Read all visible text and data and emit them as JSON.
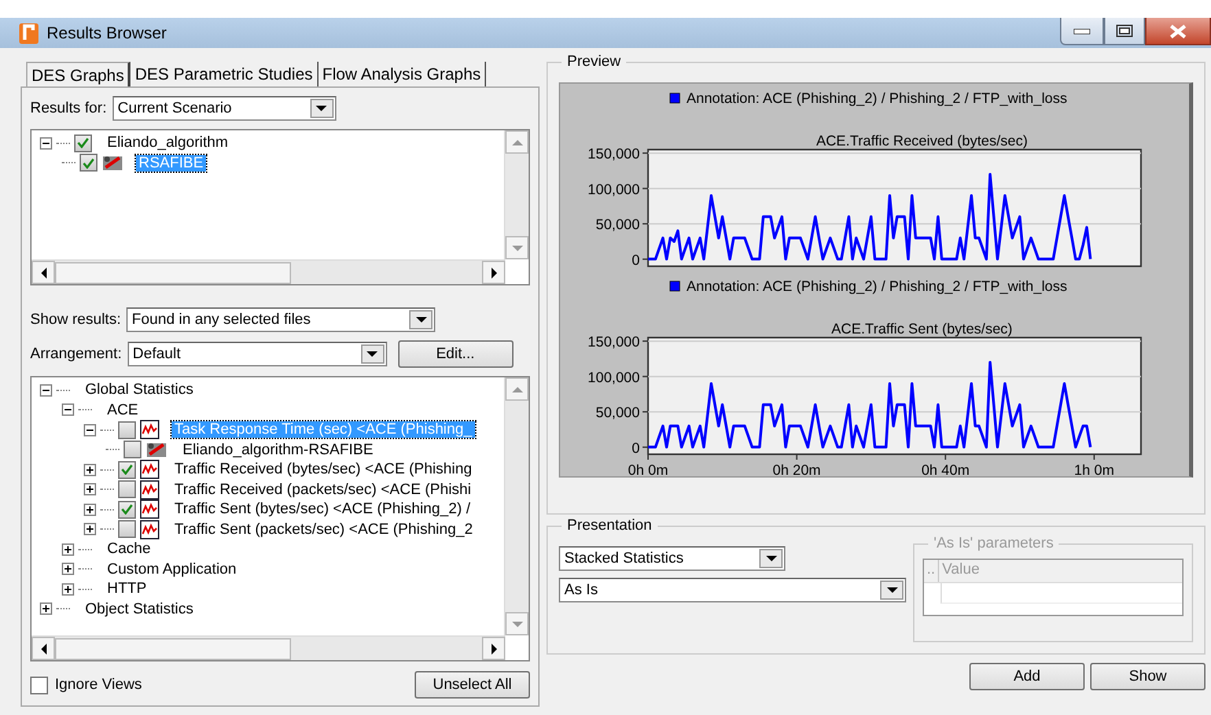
{
  "window": {
    "title": "Results Browser"
  },
  "tabs": [
    {
      "label": "DES Graphs",
      "selected": true
    },
    {
      "label": "DES Parametric Studies",
      "selected": false
    },
    {
      "label": "Flow Analysis Graphs",
      "selected": false
    }
  ],
  "results_for": {
    "label": "Results for:",
    "value": "Current Scenario"
  },
  "results_tree": [
    {
      "label": "Eliando_algorithm",
      "expanded": true,
      "checked": true,
      "selected": false,
      "children": [
        {
          "label": "RSAFIBE",
          "kind": "scenario",
          "checked": true,
          "selected": true
        }
      ]
    }
  ],
  "show_results": {
    "label": "Show results:",
    "value": "Found in any selected files"
  },
  "arrangement": {
    "label": "Arrangement:",
    "value": "Default",
    "button": "Edit..."
  },
  "statistics_tree": [
    {
      "label": "Global Statistics",
      "expanded": true,
      "selected": false,
      "children": [
        {
          "label": "ACE",
          "expanded": true,
          "selected": false,
          "children": [
            {
              "label": "Task Response Time (sec) <ACE (Phishing_",
              "kind": "statistic",
              "expanded": true,
              "checked": false,
              "selected": true,
              "children": [
                {
                  "label": "Eliando_algorithm-RSAFIBE",
                  "kind": "scenario",
                  "checked": false,
                  "selected": false
                }
              ]
            },
            {
              "label": "Traffic Received (bytes/sec) <ACE (Phishing",
              "kind": "statistic",
              "expanded": false,
              "checked": true,
              "selected": false
            },
            {
              "label": "Traffic Received (packets/sec) <ACE (Phishi",
              "kind": "statistic",
              "expanded": false,
              "checked": false,
              "selected": false
            },
            {
              "label": "Traffic Sent (bytes/sec) <ACE (Phishing_2) /",
              "kind": "statistic",
              "expanded": false,
              "checked": true,
              "selected": false
            },
            {
              "label": "Traffic Sent (packets/sec) <ACE (Phishing_2",
              "kind": "statistic",
              "expanded": false,
              "checked": false,
              "selected": false
            }
          ]
        },
        {
          "label": "Cache",
          "expanded": false,
          "selected": false
        },
        {
          "label": "Custom Application",
          "expanded": false,
          "selected": false
        },
        {
          "label": "HTTP",
          "expanded": false,
          "selected": false
        }
      ]
    },
    {
      "label": "Object Statistics",
      "expanded": false,
      "selected": false
    }
  ],
  "ignore_views": {
    "label": "Ignore Views",
    "checked": false
  },
  "unselect_all_button": "Unselect All",
  "preview": {
    "title": "Preview",
    "charts": [
      {
        "chart_data": {
          "type": "line",
          "title": "ACE.Traffic Received (bytes/sec)",
          "categories": [
            null,
            null,
            null,
            null,
            null,
            null,
            null,
            null,
            null,
            null,
            null,
            null,
            null,
            null,
            null,
            null,
            null,
            null,
            null,
            null,
            null,
            null,
            null,
            null,
            null,
            null,
            null,
            null,
            null,
            null,
            null,
            null,
            null,
            null,
            null,
            null,
            null,
            null,
            null,
            null,
            null,
            null,
            null,
            null,
            null,
            null,
            null,
            null,
            null,
            null,
            null,
            null,
            null,
            null,
            null,
            null,
            null,
            null,
            null,
            null,
            null,
            null,
            null,
            null,
            null,
            null,
            null,
            null,
            null,
            null,
            null,
            null,
            null,
            null,
            null,
            null,
            null,
            null,
            null,
            null,
            null,
            null,
            null,
            null,
            null,
            null,
            null,
            null,
            null,
            null,
            null,
            null,
            null,
            null,
            null,
            null,
            null,
            null,
            null,
            null,
            null,
            null,
            null,
            null,
            null,
            null,
            null,
            null,
            null,
            null,
            null,
            null,
            null,
            null,
            null,
            null,
            null,
            null,
            null,
            null,
            null
          ],
          "series": [
            {
              "name": "Annotation: ACE (Phishing_2) / Phishing_2 / FTP_with_loss",
              "color": "#0000ff",
              "values": [
                0,
                0,
                0,
                15000,
                30000,
                0,
                30000,
                25000,
                40000,
                0,
                15000,
                30000,
                0,
                15000,
                30000,
                0,
                45000,
                90000,
                60000,
                30000,
                60000,
                30000,
                0,
                30000,
                30000,
                30000,
                30000,
                15000,
                0,
                0,
                0,
                60000,
                60000,
                60000,
                30000,
                45000,
                60000,
                0,
                30000,
                30000,
                30000,
                30000,
                15000,
                0,
                30000,
                60000,
                30000,
                0,
                15000,
                30000,
                15000,
                0,
                0,
                30000,
                60000,
                0,
                30000,
                15000,
                0,
                30000,
                60000,
                0,
                0,
                0,
                0,
                90000,
                30000,
                60000,
                60000,
                60000,
                0,
                90000,
                30000,
                30000,
                30000,
                30000,
                30000,
                0,
                60000,
                0,
                0,
                0,
                0,
                0,
                30000,
                0,
                45000,
                90000,
                30000,
                30000,
                15000,
                0,
                120000,
                60000,
                0,
                45000,
                90000,
                60000,
                30000,
                45000,
                60000,
                0,
                15000,
                30000,
                15000,
                0,
                0,
                0,
                0,
                0,
                30000,
                60000,
                90000,
                60000,
                30000,
                0,
                0,
                20000,
                45000,
                0,
                null
              ]
            }
          ],
          "ylim": [
            -10000,
            155000
          ],
          "grid": true,
          "yticks": [
            {
              "value": 0,
              "label": "0"
            },
            {
              "value": 50000,
              "label": "50,000"
            },
            {
              "value": 100000,
              "label": "100,000"
            },
            {
              "value": 150000,
              "label": "150,000"
            }
          ]
        }
      },
      {
        "chart_data": {
          "type": "line",
          "title": "ACE.Traffic Sent (bytes/sec)",
          "categories": [
            "0h 0m",
            null,
            null,
            null,
            null,
            null,
            null,
            null,
            null,
            null,
            null,
            null,
            null,
            null,
            null,
            null,
            null,
            null,
            null,
            null,
            null,
            null,
            null,
            null,
            null,
            null,
            null,
            null,
            null,
            null,
            null,
            null,
            null,
            null,
            null,
            null,
            null,
            null,
            null,
            null,
            "0h 20m",
            null,
            null,
            null,
            null,
            null,
            null,
            null,
            null,
            null,
            null,
            null,
            null,
            null,
            null,
            null,
            null,
            null,
            null,
            null,
            null,
            null,
            null,
            null,
            null,
            null,
            null,
            null,
            null,
            null,
            null,
            null,
            null,
            null,
            null,
            null,
            null,
            null,
            null,
            null,
            "0h 40m",
            null,
            null,
            null,
            null,
            null,
            null,
            null,
            null,
            null,
            null,
            null,
            null,
            null,
            null,
            null,
            null,
            null,
            null,
            null,
            null,
            null,
            null,
            null,
            null,
            null,
            null,
            null,
            null,
            null,
            null,
            null,
            null,
            null,
            null,
            null,
            null,
            null,
            null,
            null,
            "1h 0m"
          ],
          "series": [
            {
              "name": "Annotation: ACE (Phishing_2) / Phishing_2 / FTP_with_loss",
              "color": "#0000ff",
              "values": [
                0,
                0,
                0,
                15000,
                30000,
                0,
                30000,
                30000,
                30000,
                0,
                15000,
                30000,
                0,
                15000,
                30000,
                0,
                45000,
                90000,
                60000,
                30000,
                60000,
                30000,
                0,
                30000,
                30000,
                30000,
                30000,
                15000,
                0,
                0,
                0,
                60000,
                60000,
                60000,
                30000,
                45000,
                60000,
                0,
                30000,
                30000,
                30000,
                30000,
                15000,
                0,
                30000,
                60000,
                30000,
                0,
                15000,
                30000,
                15000,
                0,
                0,
                30000,
                60000,
                0,
                30000,
                15000,
                0,
                30000,
                60000,
                0,
                0,
                0,
                0,
                90000,
                30000,
                60000,
                60000,
                60000,
                0,
                90000,
                30000,
                30000,
                30000,
                30000,
                30000,
                0,
                60000,
                0,
                0,
                0,
                0,
                0,
                30000,
                0,
                45000,
                90000,
                30000,
                30000,
                15000,
                0,
                120000,
                60000,
                0,
                45000,
                90000,
                60000,
                30000,
                45000,
                60000,
                0,
                15000,
                30000,
                15000,
                0,
                0,
                0,
                0,
                0,
                30000,
                60000,
                90000,
                60000,
                30000,
                0,
                15000,
                30000,
                30000,
                0,
                null
              ]
            }
          ],
          "ylim": [
            -10000,
            155000
          ],
          "grid": true,
          "yticks": [
            {
              "value": 0,
              "label": "0"
            },
            {
              "value": 50000,
              "label": "50,000"
            },
            {
              "value": 100000,
              "label": "100,000"
            },
            {
              "value": 150000,
              "label": "150,000"
            }
          ]
        }
      }
    ]
  },
  "presentation": {
    "title": "Presentation",
    "type_value": "Stacked Statistics",
    "filter_value": "As Is",
    "parameters": {
      "title": "'As Is' parameters",
      "disabled": true,
      "columns": [
        "..",
        "Value"
      ]
    }
  },
  "buttons": [
    "Add",
    "Show"
  ]
}
